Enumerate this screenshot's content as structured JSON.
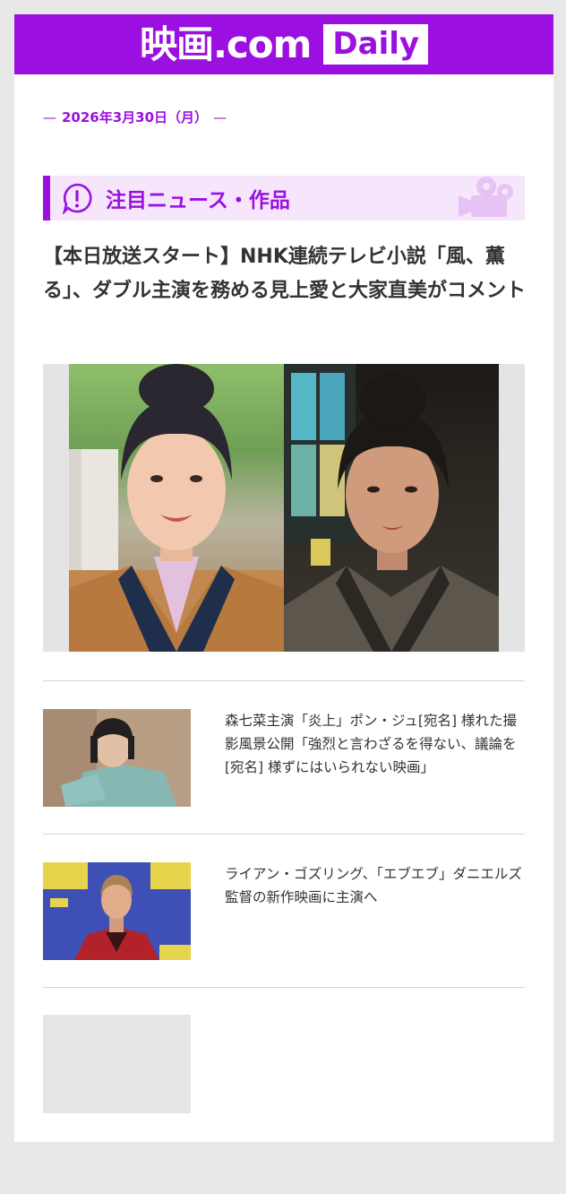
{
  "header": {
    "logo_text": "映画.com",
    "logo_badge": "Daily"
  },
  "date_line": {
    "dash_left": "—",
    "date": "2026年3月30日（月）",
    "dash_right": "—"
  },
  "section": {
    "title": "注目ニュース・作品",
    "icon": "exclamation-circle-icon",
    "decor_icon": "movie-camera-icon"
  },
  "featured": {
    "headline": "【本日放送スタート】NHK連続テレビ小説「風、薫る」、ダブル主演を務める見上愛と大家直美がコメント"
  },
  "news_items": [
    {
      "text": "森七菜主演「炎上」ポン・ジュ[宛名] 様れた撮影風景公開「強烈と言わざるを得ない、議論を[宛名] 様ずにはいられない映画」"
    },
    {
      "text": "ライアン・ゴズリング、「エブエブ」ダニエルズ監督の新作映画に主演へ"
    }
  ],
  "colors": {
    "brand": "#9b10e0",
    "section_bg": "#f5e6fb",
    "page_bg": "#e8e8e8"
  }
}
